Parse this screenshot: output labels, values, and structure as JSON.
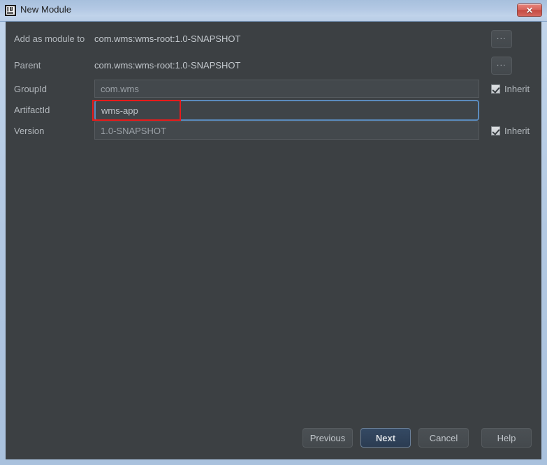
{
  "window": {
    "title": "New Module",
    "app_icon": "intellij-idea-icon",
    "close_label": "✕"
  },
  "form": {
    "rows": [
      {
        "label": "Add as module to",
        "value": "com.wms:wms-root:1.0-SNAPSHOT"
      },
      {
        "label": "Parent",
        "value": "com.wms:wms-root:1.0-SNAPSHOT"
      },
      {
        "label": "GroupId",
        "value": "com.wms"
      },
      {
        "label": "ArtifactId",
        "value": "wms-app"
      },
      {
        "label": "Version",
        "value": "1.0-SNAPSHOT"
      }
    ],
    "browse_label": "...",
    "inherit_label": "Inherit"
  },
  "footer": {
    "previous": "Previous",
    "next": "Next",
    "cancel": "Cancel",
    "help": "Help"
  },
  "colors": {
    "titlebar": "#b4c9e4",
    "content_bg": "#3c4043",
    "focus_border": "#5b8bbd",
    "annotation": "#e81b1b",
    "default_button": "#344963"
  }
}
